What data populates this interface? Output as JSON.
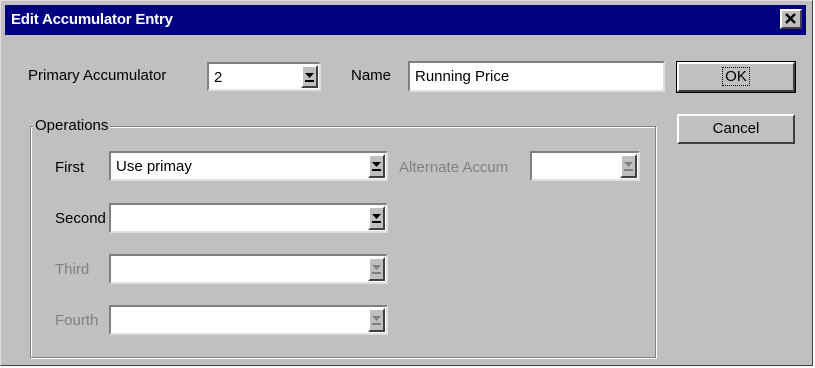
{
  "window": {
    "title": "Edit Accumulator Entry",
    "close_glyph": "✕"
  },
  "primary": {
    "label": "Primary Accumulator",
    "value": "2"
  },
  "name": {
    "label": "Name",
    "value": "Running Price"
  },
  "buttons": {
    "ok": "OK",
    "cancel": "Cancel"
  },
  "operations": {
    "legend": "Operations",
    "first": {
      "label": "First",
      "value": "Use primay"
    },
    "second": {
      "label": "Second",
      "value": ""
    },
    "third": {
      "label": "Third",
      "value": ""
    },
    "fourth": {
      "label": "Fourth",
      "value": ""
    },
    "alternate": {
      "label": "Alternate Accum",
      "value": ""
    }
  },
  "icons": {
    "dropdown": "chevron-down-icon",
    "close": "close-icon"
  }
}
